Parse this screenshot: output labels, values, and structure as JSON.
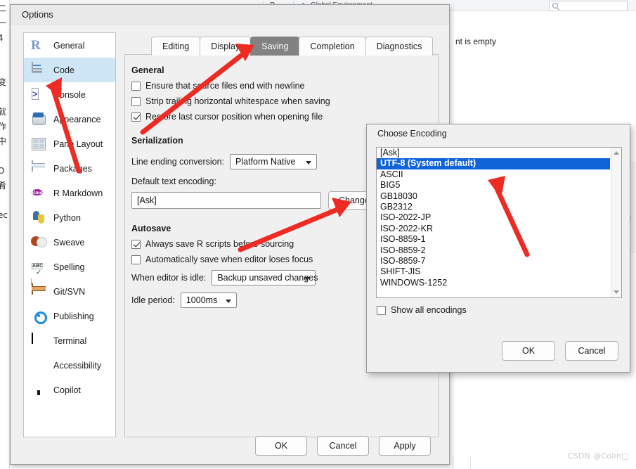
{
  "background": {
    "left_margin_text": "二\n一\n4\n\n\n变\n\n就\n作\n中\n\nO\n肴\n\nec",
    "toolbar": {
      "r_button_label": "R",
      "environment_label": "Global Environment",
      "search_placeholder": ""
    },
    "environment_message": "nt is empty"
  },
  "options_dialog": {
    "title": "Options",
    "sidebar": {
      "items": [
        {
          "label": "General",
          "icon": "r-logo-icon",
          "selected": false
        },
        {
          "label": "Code",
          "icon": "code-page-icon",
          "selected": true
        },
        {
          "label": "Console",
          "icon": "console-prompt-icon",
          "selected": false
        },
        {
          "label": "Appearance",
          "icon": "paint-bucket-icon",
          "selected": false
        },
        {
          "label": "Pane Layout",
          "icon": "pane-grid-icon",
          "selected": false
        },
        {
          "label": "Packages",
          "icon": "package-box-icon",
          "selected": false
        },
        {
          "label": "R Markdown",
          "icon": "rmd-badge-icon",
          "selected": false
        },
        {
          "label": "Python",
          "icon": "python-icon",
          "selected": false
        },
        {
          "label": "Sweave",
          "icon": "sweave-pdf-icon",
          "selected": false
        },
        {
          "label": "Spelling",
          "icon": "spellcheck-icon",
          "selected": false
        },
        {
          "label": "Git/SVN",
          "icon": "git-box-icon",
          "selected": false
        },
        {
          "label": "Publishing",
          "icon": "publishing-icon",
          "selected": false
        },
        {
          "label": "Terminal",
          "icon": "terminal-icon",
          "selected": false
        },
        {
          "label": "Accessibility",
          "icon": "accessibility-icon",
          "selected": false
        },
        {
          "label": "Copilot",
          "icon": "github-copilot-icon",
          "selected": false
        }
      ]
    },
    "tabs": [
      {
        "label": "Editing",
        "active": false
      },
      {
        "label": "Display",
        "active": false
      },
      {
        "label": "Saving",
        "active": true
      },
      {
        "label": "Completion",
        "active": false
      },
      {
        "label": "Diagnostics",
        "active": false
      }
    ],
    "sections": {
      "general": {
        "heading": "General",
        "checkboxes": [
          {
            "label": "Ensure that source files end with newline",
            "checked": false
          },
          {
            "label": "Strip trailing horizontal whitespace when saving",
            "checked": false
          },
          {
            "label": "Restore last cursor position when opening file",
            "checked": true
          }
        ]
      },
      "serialization": {
        "heading": "Serialization",
        "line_ending_label": "Line ending conversion:",
        "line_ending_value": "Platform Native",
        "default_encoding_label": "Default text encoding:",
        "default_encoding_value": "[Ask]",
        "change_button": "Change..."
      },
      "autosave": {
        "heading": "Autosave",
        "checkboxes": [
          {
            "label": "Always save R scripts before sourcing",
            "checked": true
          },
          {
            "label": "Automatically save when editor loses focus",
            "checked": false
          }
        ],
        "idle_label": "When editor is idle:",
        "idle_value": "Backup unsaved changes",
        "idle_period_label": "Idle period:",
        "idle_period_value": "1000ms"
      }
    },
    "footer": {
      "ok": "OK",
      "cancel": "Cancel",
      "apply": "Apply"
    }
  },
  "encoding_dialog": {
    "title": "Choose Encoding",
    "items": [
      {
        "label": "[Ask]",
        "selected": false
      },
      {
        "label": "UTF-8 (System default)",
        "selected": true
      },
      {
        "label": "ASCII",
        "selected": false
      },
      {
        "label": "BIG5",
        "selected": false
      },
      {
        "label": "GB18030",
        "selected": false
      },
      {
        "label": "GB2312",
        "selected": false
      },
      {
        "label": "ISO-2022-JP",
        "selected": false
      },
      {
        "label": "ISO-2022-KR",
        "selected": false
      },
      {
        "label": "ISO-8859-1",
        "selected": false
      },
      {
        "label": "ISO-8859-2",
        "selected": false
      },
      {
        "label": "ISO-8859-7",
        "selected": false
      },
      {
        "label": "SHIFT-JIS",
        "selected": false
      },
      {
        "label": "WINDOWS-1252",
        "selected": false
      }
    ],
    "show_all_label": "Show all encodings",
    "show_all_checked": false,
    "ok": "OK",
    "cancel": "Cancel"
  },
  "annotations": {
    "arrow_color": "#ee2b23",
    "arrows": [
      {
        "name": "arrow-to-saving-tab"
      },
      {
        "name": "arrow-to-code-sidebar"
      },
      {
        "name": "arrow-to-change-button"
      },
      {
        "name": "arrow-to-utf8-item"
      }
    ]
  },
  "watermark": {
    "text": "CSDN @Colin□"
  }
}
